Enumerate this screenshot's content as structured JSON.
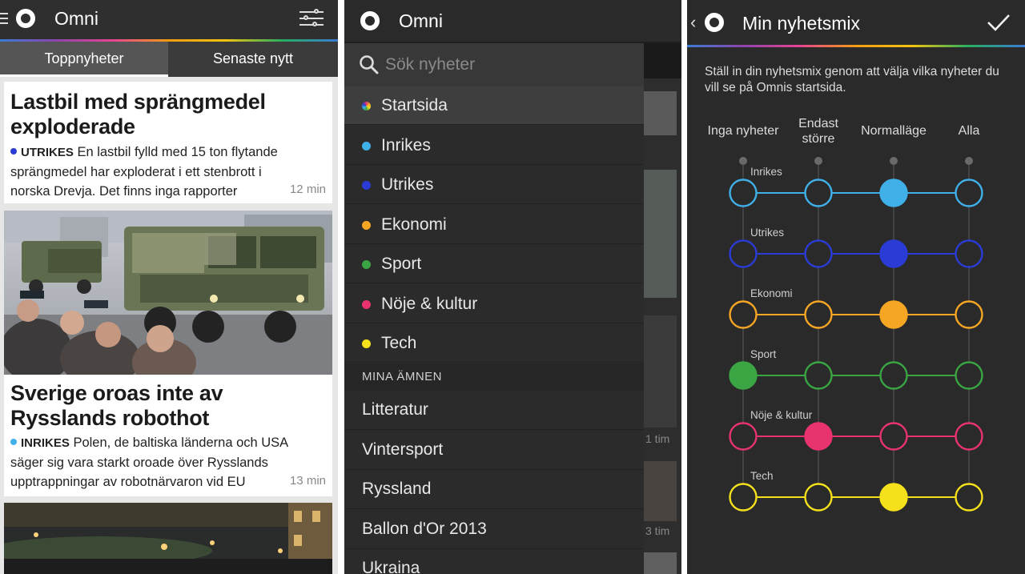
{
  "screen1": {
    "app_title": "Omni",
    "tabs": [
      "Toppnyheter",
      "Senaste nytt"
    ],
    "articles": [
      {
        "title_lines": [
          "Lastbil med sprängmedel",
          "exploderade"
        ],
        "category": "UTRIKES",
        "category_color": "#2b3bd6",
        "body_lines": [
          "En lastbil fylld med 15 ton flytande",
          "sprängmedel har exploderat i ett stenbrott i",
          "norska Drevja. Det finns inga rapporter"
        ],
        "time": "12 min"
      },
      {
        "title_lines": [
          "Sverige oroas inte av",
          "Rysslands robothot"
        ],
        "category": "INRIKES",
        "category_color": "#3fb0e8",
        "body_lines": [
          "Polen, de baltiska länderna och USA",
          "säger sig vara starkt oroade över Rysslands",
          "upptrappningar av robotnärvaron vid EU"
        ],
        "time": "13 min"
      }
    ]
  },
  "screen2": {
    "app_title": "Omni",
    "search_placeholder": "Sök nyheter",
    "menu": [
      {
        "label": "Startsida",
        "color": "multicolor"
      },
      {
        "label": "Inrikes",
        "color": "#3fb0e8"
      },
      {
        "label": "Utrikes",
        "color": "#2b3bd6"
      },
      {
        "label": "Ekonomi",
        "color": "#f5a623"
      },
      {
        "label": "Sport",
        "color": "#3aa543"
      },
      {
        "label": "Nöje & kultur",
        "color": "#e8336f"
      },
      {
        "label": "Tech",
        "color": "#f5e11b"
      }
    ],
    "section_header": "MINA ÄMNEN",
    "topics": [
      "Litteratur",
      "Vintersport",
      "Ryssland",
      "Ballon d'Or 2013",
      "Ukraina"
    ],
    "peek_times": [
      "1 tim",
      "3 tim"
    ]
  },
  "screen3": {
    "title": "Min nyhetsmix",
    "intro": "Ställ in din nyhetsmix genom att välja vilka nyheter du vill se på Omnis startsida.",
    "columns": [
      {
        "line1": "Inga nyheter",
        "line2": ""
      },
      {
        "line1": "Endast",
        "line2": "större"
      },
      {
        "line1": "Normalläge",
        "line2": ""
      },
      {
        "line1": "Alla",
        "line2": ""
      }
    ],
    "rows": [
      {
        "label": "Inrikes",
        "color": "#3fb0e8",
        "selected": 2
      },
      {
        "label": "Utrikes",
        "color": "#2b3bd6",
        "selected": 2
      },
      {
        "label": "Ekonomi",
        "color": "#f5a623",
        "selected": 2
      },
      {
        "label": "Sport",
        "color": "#3aa543",
        "selected": 0
      },
      {
        "label": "Nöje & kultur",
        "color": "#e8336f",
        "selected": 1
      },
      {
        "label": "Tech",
        "color": "#f5e11b",
        "selected": 2
      }
    ]
  }
}
